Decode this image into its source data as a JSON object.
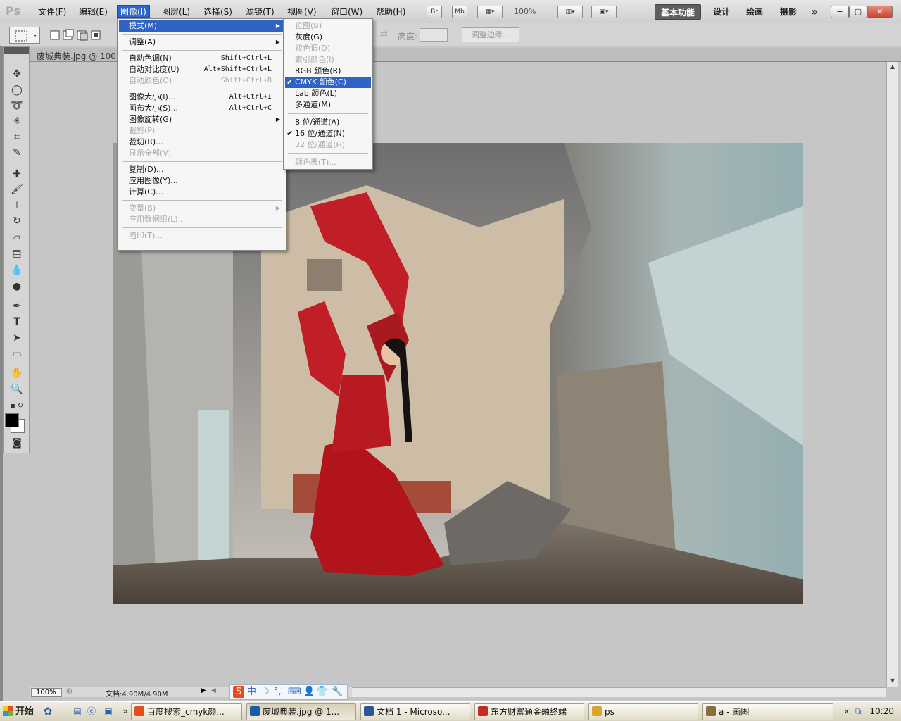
{
  "app": {
    "logo": "Ps",
    "menus": [
      "文件(F)",
      "编辑(E)",
      "图像(I)",
      "图层(L)",
      "选择(S)",
      "滤镜(T)",
      "视图(V)",
      "窗口(W)",
      "帮助(H)"
    ],
    "bridge_label": "Br",
    "minibridge_label": "Mb",
    "zoom": "100%",
    "workspaces": [
      "基本功能",
      "设计",
      "绘画",
      "摄影"
    ],
    "more_workspaces": "»",
    "win_min": "−",
    "win_max": "▢",
    "win_close": "✕"
  },
  "options": {
    "height_label": "高度:",
    "refine_edge": "调整边缘..."
  },
  "document": {
    "tab_title": "废城典装.jpg @ 100",
    "zoom_field": "100%",
    "doc_size": "文档:4.90M/4.90M"
  },
  "image_menu": [
    {
      "label": "模式(M)",
      "submenu": true,
      "highlight": true
    },
    {
      "sep": true
    },
    {
      "label": "调整(A)",
      "submenu": true
    },
    {
      "sep": true
    },
    {
      "label": "自动色调(N)",
      "shortcut": "Shift+Ctrl+L"
    },
    {
      "label": "自动对比度(U)",
      "shortcut": "Alt+Shift+Ctrl+L"
    },
    {
      "label": "自动颜色(O)",
      "shortcut": "Shift+Ctrl+B",
      "disabled": true
    },
    {
      "sep": true
    },
    {
      "label": "图像大小(I)...",
      "shortcut": "Alt+Ctrl+I"
    },
    {
      "label": "画布大小(S)...",
      "shortcut": "Alt+Ctrl+C"
    },
    {
      "label": "图像旋转(G)",
      "submenu": true
    },
    {
      "label": "裁剪(P)",
      "disabled": true
    },
    {
      "label": "裁切(R)..."
    },
    {
      "label": "显示全部(V)",
      "disabled": true
    },
    {
      "sep": true
    },
    {
      "label": "复制(D)..."
    },
    {
      "label": "应用图像(Y)..."
    },
    {
      "label": "计算(C)..."
    },
    {
      "sep": true
    },
    {
      "label": "变量(B)",
      "submenu": true,
      "disabled": true
    },
    {
      "label": "应用数据组(L)...",
      "disabled": true
    },
    {
      "sep": true
    },
    {
      "label": "陷印(T)...",
      "disabled": true
    }
  ],
  "mode_menu": [
    {
      "label": "位图(B)",
      "disabled": true
    },
    {
      "label": "灰度(G)"
    },
    {
      "label": "双色调(D)",
      "disabled": true
    },
    {
      "label": "索引颜色(I)",
      "disabled": true
    },
    {
      "label": "RGB 颜色(R)"
    },
    {
      "label": "CMYK 颜色(C)",
      "checked": true,
      "highlight": true
    },
    {
      "label": "Lab 颜色(L)"
    },
    {
      "label": "多通道(M)"
    },
    {
      "sep": true
    },
    {
      "label": "8 位/通道(A)"
    },
    {
      "label": "16 位/通道(N)",
      "checked": true
    },
    {
      "label": "32 位/通道(H)",
      "disabled": true
    },
    {
      "sep": true
    },
    {
      "label": "颜色表(T)...",
      "disabled": true
    }
  ],
  "taskbar": {
    "start": "开始",
    "tasks": [
      {
        "label": "百度搜索_cmyk颜...",
        "icon_color": "#e0501a"
      },
      {
        "label": "废城典装.jpg @ 1...",
        "icon_color": "#1a5aa8",
        "active": true
      },
      {
        "label": "文档 1 - Microso...",
        "icon_color": "#2b579a"
      },
      {
        "label": "东方财富通金融终端",
        "icon_color": "#c62b21"
      },
      {
        "label": "ps",
        "icon_color": "#d9a52b"
      },
      {
        "label": "a - 画图",
        "icon_color": "#8a6d3b"
      }
    ],
    "more": "»",
    "tray_expand": "«",
    "clock": "10:20"
  },
  "ime": {
    "icons": [
      "S",
      "中",
      "☽",
      "°,",
      "⌨",
      "👤",
      "👕",
      "🔧"
    ]
  },
  "colors": {
    "menu_highlight": "#2f63c5",
    "active_menu": "#2a66d0",
    "foreground": "#000000",
    "background": "#ffffff"
  }
}
